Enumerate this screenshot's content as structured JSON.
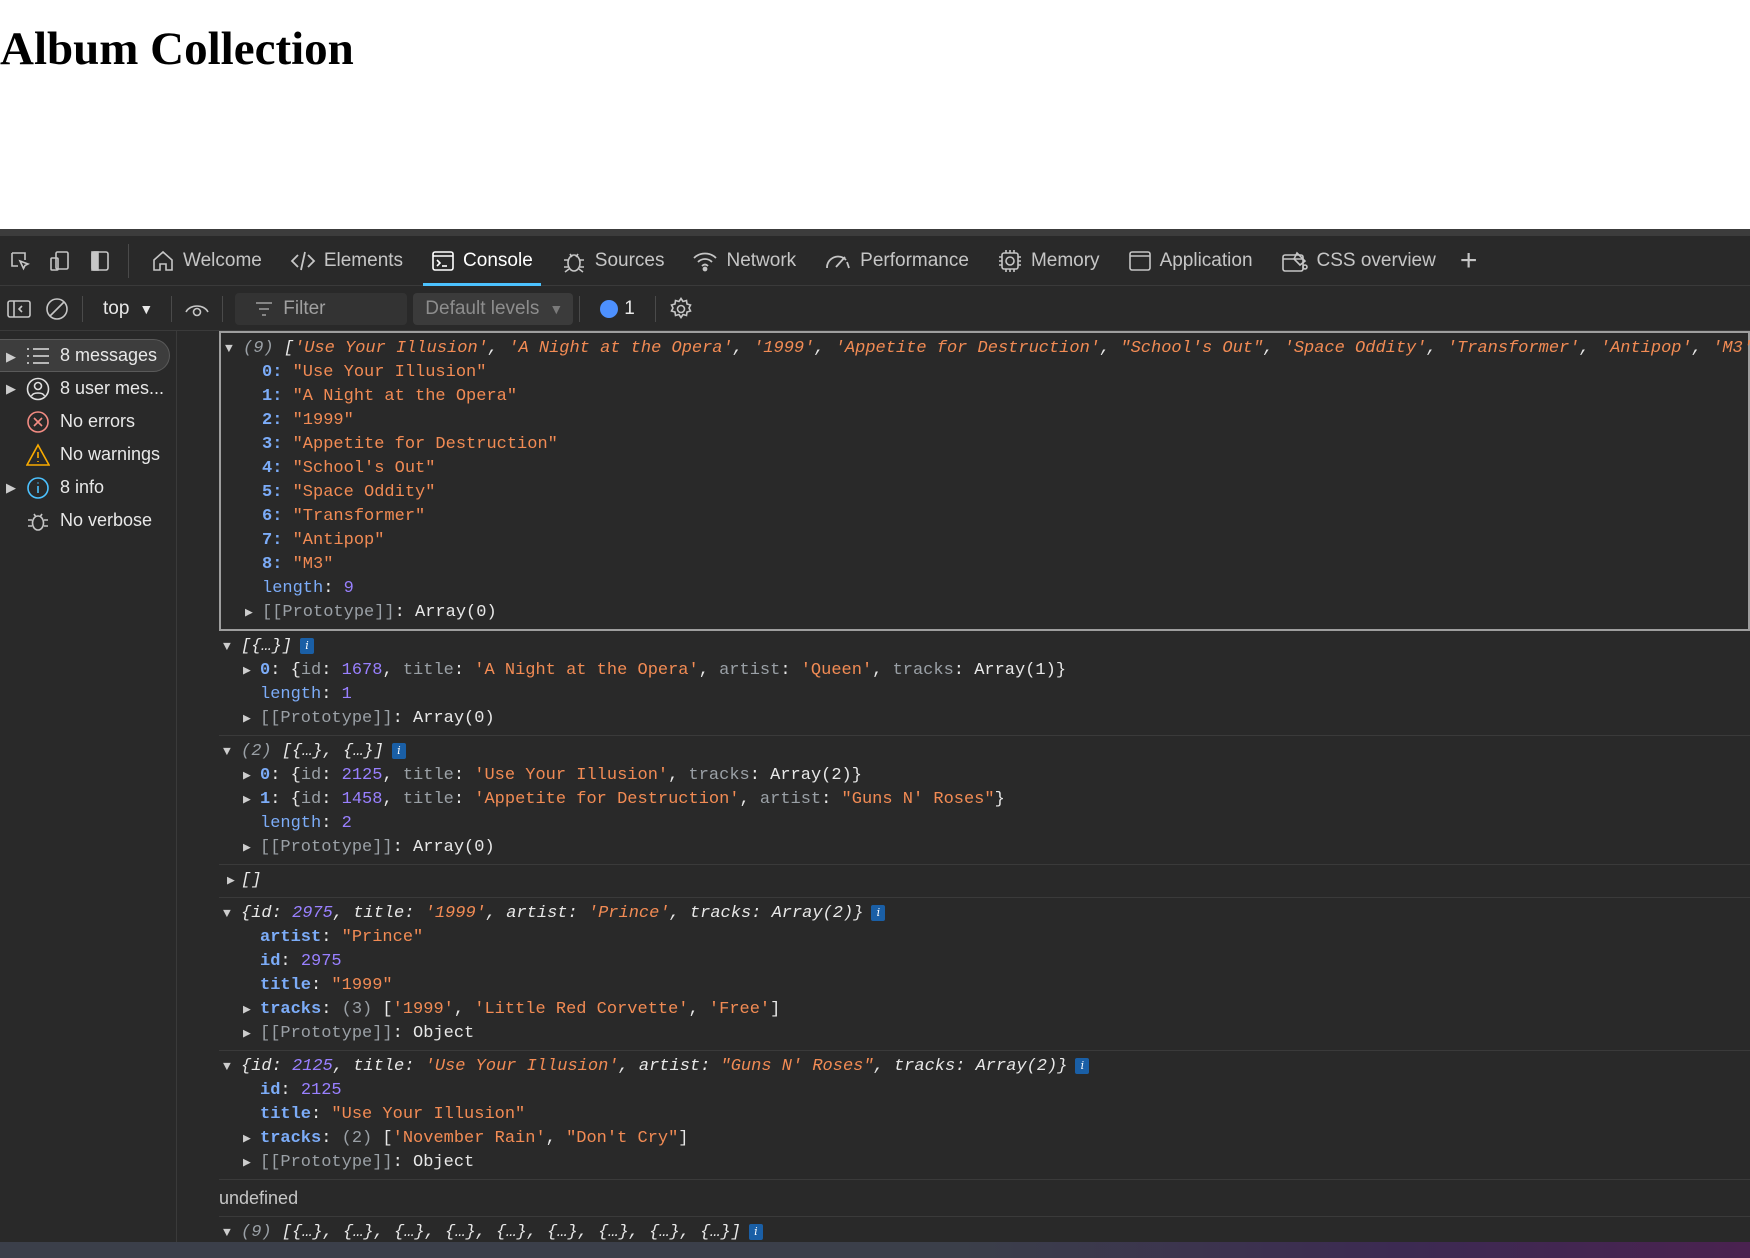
{
  "page": {
    "title": "Album Collection"
  },
  "devtools": {
    "tabs": [
      {
        "label": "Welcome",
        "icon": "home-icon"
      },
      {
        "label": "Elements",
        "icon": "code-icon"
      },
      {
        "label": "Console",
        "icon": "console-icon",
        "active": true
      },
      {
        "label": "Sources",
        "icon": "bug-icon"
      },
      {
        "label": "Network",
        "icon": "wifi-icon"
      },
      {
        "label": "Performance",
        "icon": "gauge-icon"
      },
      {
        "label": "Memory",
        "icon": "chip-icon"
      },
      {
        "label": "Application",
        "icon": "window-icon"
      },
      {
        "label": "CSS overview",
        "icon": "palette-icon"
      }
    ],
    "toolbar": {
      "context": "top",
      "filter_placeholder": "Filter",
      "levels": "Default levels",
      "issues_count": "1"
    },
    "sidebar": [
      {
        "label": "8 messages",
        "icon": "list-icon",
        "expandable": true,
        "selected": true
      },
      {
        "label": "8 user mes...",
        "icon": "user-icon",
        "expandable": true
      },
      {
        "label": "No errors",
        "icon": "error-icon",
        "color": "#f28b82"
      },
      {
        "label": "No warnings",
        "icon": "warning-icon",
        "color": "#f9ab00"
      },
      {
        "label": "8 info",
        "icon": "info-icon",
        "expandable": true,
        "color": "#4cc2ff"
      },
      {
        "label": "No verbose",
        "icon": "bug-icon"
      }
    ]
  },
  "console": {
    "e1": {
      "count": "(9)",
      "items": [
        "'Use Your Illusion'",
        "'A Night at the Opera'",
        "'1999'",
        "'Appetite for Destruction'",
        "\"School's Out\"",
        "'Space Oddity'",
        "'Transformer'",
        "'Antipop'",
        "'M3'"
      ],
      "expanded": [
        {
          "k": "0",
          "v": "\"Use Your Illusion\""
        },
        {
          "k": "1",
          "v": "\"A Night at the Opera\""
        },
        {
          "k": "2",
          "v": "\"1999\""
        },
        {
          "k": "3",
          "v": "\"Appetite for Destruction\""
        },
        {
          "k": "4",
          "v": "\"School's Out\""
        },
        {
          "k": "5",
          "v": "\"Space Oddity\""
        },
        {
          "k": "6",
          "v": "\"Transformer\""
        },
        {
          "k": "7",
          "v": "\"Antipop\""
        },
        {
          "k": "8",
          "v": "\"M3\""
        }
      ],
      "length": "9",
      "proto": "Array(0)"
    },
    "e2": {
      "summary": "[{…}]",
      "item0": {
        "id": "1678",
        "title": "'A Night at the Opera'",
        "artist": "'Queen'",
        "tracks": "Array(1)"
      },
      "length": "1",
      "proto": "Array(0)"
    },
    "e3": {
      "count": "(2)",
      "summary": "[{…}, {…}]",
      "item0": {
        "id": "2125",
        "title": "'Use Your Illusion'",
        "tracks": "Array(2)"
      },
      "item1": {
        "id": "1458",
        "title": "'Appetite for Destruction'",
        "artist": "\"Guns N' Roses\""
      },
      "length": "2",
      "proto": "Array(0)"
    },
    "e4": {
      "summary": "[]"
    },
    "e5": {
      "id": "2975",
      "title": "'1999'",
      "artist": "'Prince'",
      "tracks": "Array(2)",
      "artist_full": "\"Prince\"",
      "title_full": "\"1999\"",
      "tracks_count": "(3)",
      "tracks_items": [
        "'1999'",
        "'Little Red Corvette'",
        "'Free'"
      ],
      "proto": "Object"
    },
    "e6": {
      "id": "2125",
      "title": "'Use Your Illusion'",
      "artist": "\"Guns N' Roses\"",
      "tracks": "Array(2)",
      "title_full": "\"Use Your Illusion\"",
      "tracks_count": "(2)",
      "tracks_items": [
        "'November Rain'",
        "\"Don't Cry\""
      ],
      "proto": "Object"
    },
    "undefined_text": "undefined",
    "e7": {
      "count": "(9)",
      "summary": "[{…}, {…}, {…}, {…}, {…}, {…}, {…}, {…}, {…}]"
    }
  }
}
